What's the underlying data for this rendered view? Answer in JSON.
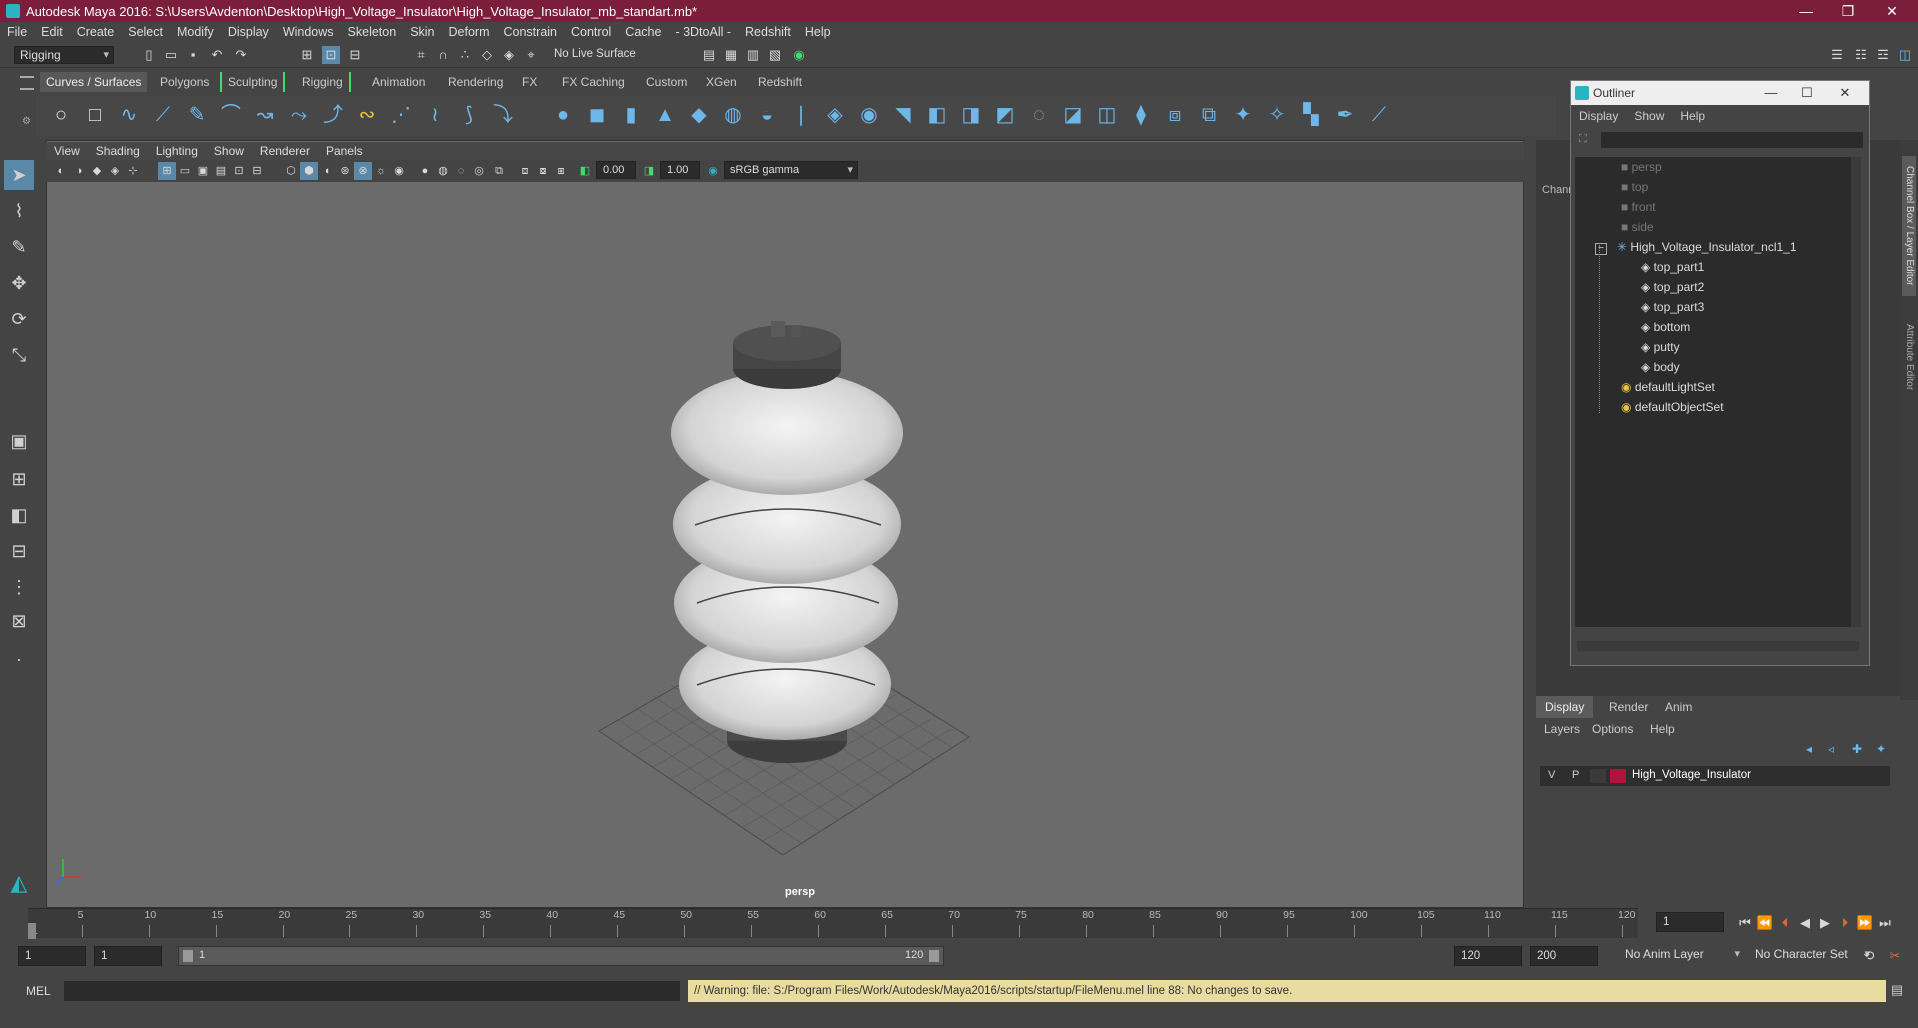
{
  "window": {
    "title": "Autodesk Maya 2016: S:\\Users\\Avdenton\\Desktop\\High_Voltage_Insulator\\High_Voltage_Insulator_mb_standart.mb*"
  },
  "menubar": [
    "File",
    "Edit",
    "Create",
    "Select",
    "Modify",
    "Display",
    "Windows",
    "Skeleton",
    "Skin",
    "Deform",
    "Constrain",
    "Control",
    "Cache",
    "- 3DtoAll -",
    "Redshift",
    "Help"
  ],
  "status": {
    "mode": "Rigging",
    "live_surface": "No Live Surface"
  },
  "shelf_tabs": [
    "Curves / Surfaces",
    "Polygons",
    "Sculpting",
    "Rigging",
    "Animation",
    "Rendering",
    "FX",
    "FX Caching",
    "Custom",
    "XGen",
    "Redshift"
  ],
  "viewport": {
    "menu": [
      "View",
      "Shading",
      "Lighting",
      "Show",
      "Renderer",
      "Panels"
    ],
    "exposure": "0.00",
    "gamma": "1.00",
    "color_space": "sRGB gamma",
    "camera_label": "persp"
  },
  "outliner": {
    "title": "Outliner",
    "menu": [
      "Display",
      "Show",
      "Help"
    ],
    "items": [
      "persp",
      "top",
      "front",
      "side",
      "High_Voltage_Insulator_ncl1_1",
      "top_part1",
      "top_part2",
      "top_part3",
      "bottom",
      "putty",
      "body",
      "defaultLightSet",
      "defaultObjectSet"
    ]
  },
  "channel_box_label": "Chann",
  "side_tabs": [
    "Channel Box / Layer Editor",
    "Attribute Editor"
  ],
  "layer_editor": {
    "tabs": [
      "Display",
      "Render",
      "Anim"
    ],
    "menu": [
      "Layers",
      "Options",
      "Help"
    ],
    "layer": {
      "v": "V",
      "p": "P",
      "name": "High_Voltage_Insulator",
      "color": "#b0143c"
    }
  },
  "timeline": {
    "ticks": [
      "1",
      "5",
      "10",
      "15",
      "20",
      "25",
      "30",
      "35",
      "40",
      "45",
      "50",
      "55",
      "60",
      "65",
      "70",
      "75",
      "80",
      "85",
      "90",
      "95",
      "100",
      "105",
      "110",
      "115",
      "120"
    ],
    "current_frame": "1"
  },
  "range": {
    "start": "1",
    "playback_start": "1",
    "slider_start": "1",
    "slider_end": "120",
    "playback_end": "120",
    "end": "200",
    "anim_layer": "No Anim Layer",
    "character_set": "No Character Set"
  },
  "command": {
    "lang": "MEL",
    "warning": "// Warning: file: S:/Program Files/Work/Autodesk/Maya2016/scripts/startup/FileMenu.mel line 88: No changes to save."
  }
}
